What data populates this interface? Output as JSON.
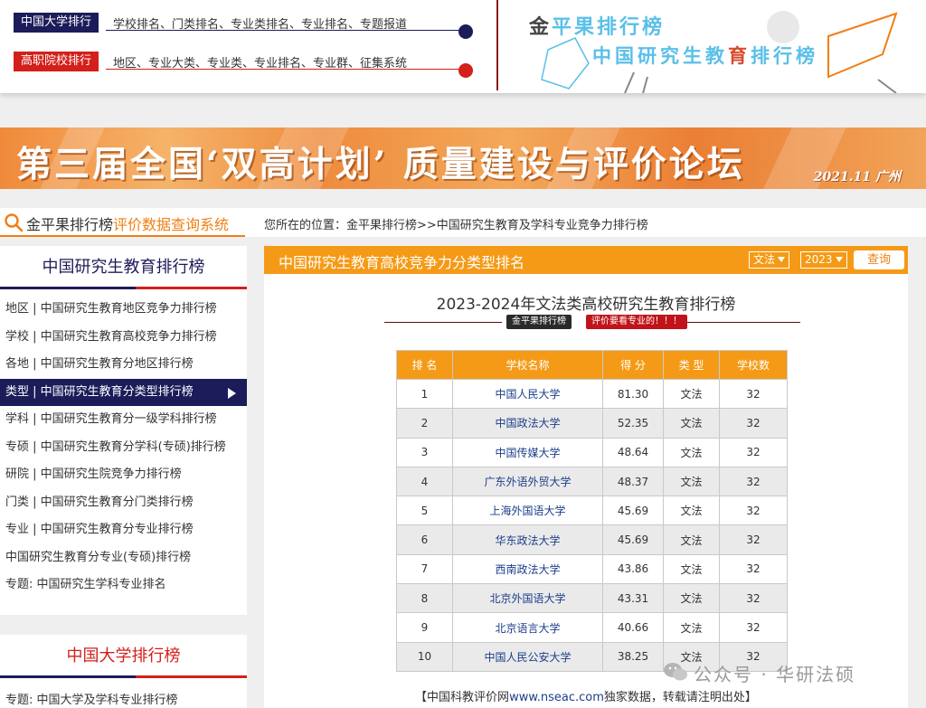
{
  "header": {
    "nav": [
      {
        "tag": "中国大学排行",
        "links": "学校排名、门类排名、专业类排名、专业排名、专题报道"
      },
      {
        "tag": "高职院校排行",
        "links": "地区、专业大类、专业类、专业排名、专业群、征集系统"
      }
    ],
    "brand_title_a": "金",
    "brand_title_b": "平果排行榜",
    "brand_sub_a": "中国研究生教",
    "brand_sub_b": "育",
    "brand_sub_c": "排行榜"
  },
  "banner": {
    "title": "第三届全国‘双高计划’ 质量建设与评价论坛",
    "sub": "2021.11  广州"
  },
  "search": {
    "title_a": "金平果排行榜",
    "title_b": "评价数据查询系统",
    "breadcrumb": "您所在的位置：金平果排行榜>>中国研究生教育及学科专业竞争力排行榜"
  },
  "sidebar": {
    "heading": "中国研究生教育排行榜",
    "items": [
      "地区 | 中国研究生教育地区竞争力排行榜",
      "学校 | 中国研究生教育高校竞争力排行榜",
      "各地 | 中国研究生教育分地区排行榜",
      "类型 | 中国研究生教育分类型排行榜",
      "学科 | 中国研究生教育分一级学科排行榜",
      "专硕 | 中国研究生教育分学科(专硕)排行榜",
      "研院 | 中国研究生院竞争力排行榜",
      "门类 | 中国研究生教育分门类排行榜",
      "专业 | 中国研究生教育分专业排行榜",
      "中国研究生教育分专业(专硕)排行榜",
      "专题:  中国研究生学科专业排名"
    ],
    "active_index": 3,
    "heading2": "中国大学排行榜",
    "items2": [
      "专题:  中国大学及学科专业排行榜"
    ]
  },
  "main": {
    "title": "中国研究生教育高校竞争力分类型排名",
    "select_type": "文法",
    "select_year": "2023",
    "query_label": "查询",
    "rank_title": "2023-2024年文法类高校研究生教育排行榜",
    "tag_dark": "金平果排行榜",
    "tag_red": "评价要看专业的！！！",
    "table": {
      "headers": [
        "排 名",
        "学校名称",
        "得 分",
        "类 型",
        "学校数"
      ],
      "rows": [
        [
          "1",
          "中国人民大学",
          "81.30",
          "文法",
          "32"
        ],
        [
          "2",
          "中国政法大学",
          "52.35",
          "文法",
          "32"
        ],
        [
          "3",
          "中国传媒大学",
          "48.64",
          "文法",
          "32"
        ],
        [
          "4",
          "广东外语外贸大学",
          "48.37",
          "文法",
          "32"
        ],
        [
          "5",
          "上海外国语大学",
          "45.69",
          "文法",
          "32"
        ],
        [
          "6",
          "华东政法大学",
          "45.69",
          "文法",
          "32"
        ],
        [
          "7",
          "西南政法大学",
          "43.86",
          "文法",
          "32"
        ],
        [
          "8",
          "北京外国语大学",
          "43.31",
          "文法",
          "32"
        ],
        [
          "9",
          "北京语言大学",
          "40.66",
          "文法",
          "32"
        ],
        [
          "10",
          "中国人民公安大学",
          "38.25",
          "文法",
          "32"
        ]
      ]
    },
    "footer_a": "【中国科教评价网",
    "footer_url": "www.nseac.com",
    "footer_b": "独家数据，转载请注明出处】"
  },
  "watermark": "公众号 · 华研法硕",
  "colors": {
    "navy": "#1c1c5a",
    "red": "#d3201a",
    "orange": "#f59a16",
    "link": "#1c3f8a"
  }
}
